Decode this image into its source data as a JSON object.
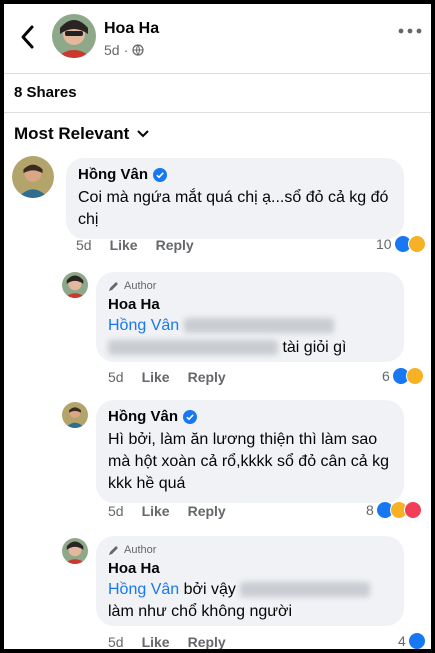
{
  "header": {
    "name": "Hoa Ha",
    "time": "5d"
  },
  "shares": "8 Shares",
  "sort_label": "Most Relevant",
  "comments": [
    {
      "name": "Hồng Vân",
      "text": "Coi mà ngứa mắt quá chị ạ...sổ đỏ cả kg đó chị",
      "time": "5d",
      "like": "Like",
      "reply": "Reply",
      "reactions": "10"
    },
    {
      "badge": "Author",
      "name": "Hoa Ha",
      "mention": "Hồng Vân",
      "text_end": "tài giỏi gì",
      "time": "5d",
      "like": "Like",
      "reply": "Reply",
      "reactions": "6"
    },
    {
      "name": "Hồng Vân",
      "text": "Hì bởi, làm ăn lương thiện thì làm sao mà hột xoàn cả rổ,kkkk sổ đỏ cân cả kg kkk hề quá",
      "time": "5d",
      "like": "Like",
      "reply": "Reply",
      "reactions": "8"
    },
    {
      "badge": "Author",
      "name": "Hoa Ha",
      "mention": "Hồng Vân",
      "text_mid": "bởi vậy",
      "text_line2": "làm như chổ không người",
      "time": "5d",
      "like": "Like",
      "reply": "Reply",
      "reactions": "4"
    }
  ],
  "colors": {
    "accent": "#1877f2",
    "bubble": "#f0f2f5",
    "muted": "#65676b"
  }
}
